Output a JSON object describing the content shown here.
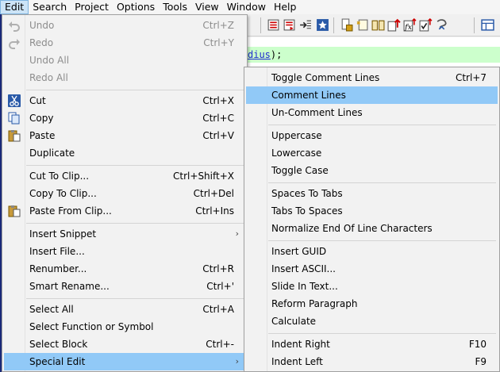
{
  "menubar": [
    "Edit",
    "Search",
    "Project",
    "Options",
    "Tools",
    "View",
    "Window",
    "Help"
  ],
  "editor": {
    "code_prefix": "",
    "code_highlight": "dius",
    "code_suffix": ");"
  },
  "edit_menu": {
    "undo": {
      "label": "Undo",
      "shortcut": "Ctrl+Z"
    },
    "redo": {
      "label": "Redo",
      "shortcut": "Ctrl+Y"
    },
    "undo_all": {
      "label": "Undo All"
    },
    "redo_all": {
      "label": "Redo All"
    },
    "cut": {
      "label": "Cut",
      "shortcut": "Ctrl+X"
    },
    "copy": {
      "label": "Copy",
      "shortcut": "Ctrl+C"
    },
    "paste": {
      "label": "Paste",
      "shortcut": "Ctrl+V"
    },
    "duplicate": {
      "label": "Duplicate"
    },
    "cut_to_clip": {
      "label": "Cut To Clip...",
      "shortcut": "Ctrl+Shift+X"
    },
    "copy_to_clip": {
      "label": "Copy To Clip...",
      "shortcut": "Ctrl+Del"
    },
    "paste_from_clip": {
      "label": "Paste From Clip...",
      "shortcut": "Ctrl+Ins"
    },
    "insert_snippet": {
      "label": "Insert Snippet"
    },
    "insert_file": {
      "label": "Insert File..."
    },
    "renumber": {
      "label": "Renumber...",
      "shortcut": "Ctrl+R"
    },
    "smart_rename": {
      "label": "Smart Rename...",
      "shortcut": "Ctrl+'"
    },
    "select_all": {
      "label": "Select All",
      "shortcut": "Ctrl+A"
    },
    "select_function": {
      "label": "Select Function or Symbol"
    },
    "select_block": {
      "label": "Select Block",
      "shortcut": "Ctrl+-"
    },
    "special_edit": {
      "label": "Special Edit"
    }
  },
  "special_menu": {
    "toggle_comment": {
      "label": "Toggle Comment Lines",
      "shortcut": "Ctrl+7"
    },
    "comment_lines": {
      "label": "Comment Lines"
    },
    "uncomment_lines": {
      "label": "Un-Comment Lines"
    },
    "uppercase": {
      "label": "Uppercase"
    },
    "lowercase": {
      "label": "Lowercase"
    },
    "toggle_case": {
      "label": "Toggle Case"
    },
    "spaces_to_tabs": {
      "label": "Spaces To Tabs"
    },
    "tabs_to_spaces": {
      "label": "Tabs To Spaces"
    },
    "normalize_eol": {
      "label": "Normalize End Of Line Characters"
    },
    "insert_guid": {
      "label": "Insert GUID"
    },
    "insert_ascii": {
      "label": "Insert ASCII..."
    },
    "slide_in_text": {
      "label": "Slide In Text..."
    },
    "reform_paragraph": {
      "label": "Reform Paragraph"
    },
    "calculate": {
      "label": "Calculate"
    },
    "indent_right": {
      "label": "Indent Right",
      "shortcut": "F10"
    },
    "indent_left": {
      "label": "Indent Left",
      "shortcut": "F9"
    }
  },
  "colors": {
    "highlight": "#91c9f7",
    "editor_line": "#ccffcc",
    "menu_bg": "#f2f2f2"
  }
}
